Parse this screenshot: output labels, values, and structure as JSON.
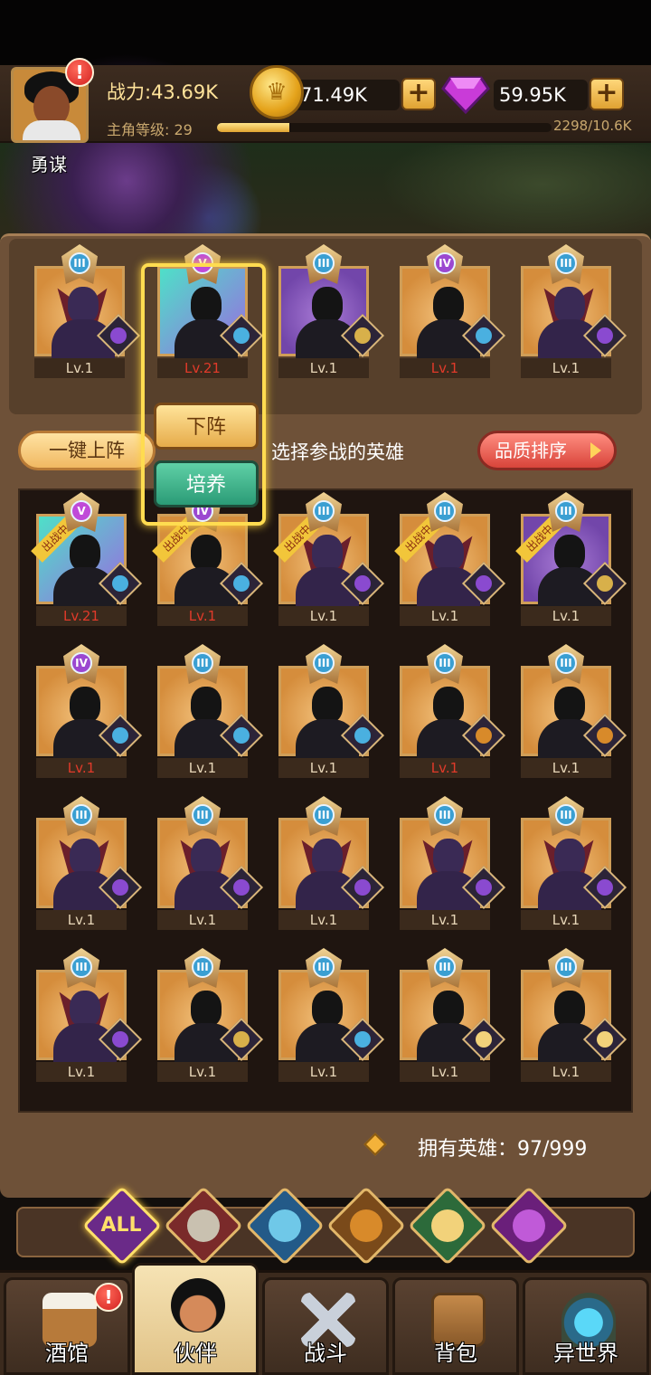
{
  "player": {
    "name": "勇谋",
    "power": "战力:43.69K",
    "level_label": "主角等级: 29",
    "exp_text": "2298/10.6K",
    "exp_progress": 0.217
  },
  "resources": {
    "coins": "71.49K",
    "gems": "59.95K",
    "plus": "+"
  },
  "lineup": [
    {
      "rank": "III",
      "level": "Lv.1",
      "level_red": false
    },
    {
      "rank": "V",
      "level": "Lv.21",
      "level_red": true
    },
    {
      "rank": "III",
      "level": "Lv.1",
      "level_red": false
    },
    {
      "rank": "IV",
      "level": "Lv.1",
      "level_red": true
    },
    {
      "rank": "III",
      "level": "Lv.1",
      "level_red": false
    }
  ],
  "popup": {
    "remove_label": "下阵",
    "train_label": "培养"
  },
  "actions": {
    "one_click_label": "一键上阵",
    "hint": "选择参战的英雄",
    "sort_label": "品质排序"
  },
  "on_field_tag": "出战中",
  "heroes": [
    {
      "rank": "V",
      "level": "Lv.21",
      "red": true,
      "on_field": true
    },
    {
      "rank": "IV",
      "level": "Lv.1",
      "red": true,
      "on_field": true
    },
    {
      "rank": "III",
      "level": "Lv.1",
      "red": false,
      "on_field": true
    },
    {
      "rank": "III",
      "level": "Lv.1",
      "red": false,
      "on_field": true
    },
    {
      "rank": "III",
      "level": "Lv.1",
      "red": false,
      "on_field": true
    },
    {
      "rank": "IV",
      "level": "Lv.1",
      "red": true,
      "on_field": false
    },
    {
      "rank": "III",
      "level": "Lv.1",
      "red": false,
      "on_field": false
    },
    {
      "rank": "III",
      "level": "Lv.1",
      "red": false,
      "on_field": false
    },
    {
      "rank": "III",
      "level": "Lv.1",
      "red": true,
      "on_field": false
    },
    {
      "rank": "III",
      "level": "Lv.1",
      "red": false,
      "on_field": false
    },
    {
      "rank": "III",
      "level": "Lv.1",
      "red": false,
      "on_field": false
    },
    {
      "rank": "III",
      "level": "Lv.1",
      "red": false,
      "on_field": false
    },
    {
      "rank": "III",
      "level": "Lv.1",
      "red": false,
      "on_field": false
    },
    {
      "rank": "III",
      "level": "Lv.1",
      "red": false,
      "on_field": false
    },
    {
      "rank": "III",
      "level": "Lv.1",
      "red": false,
      "on_field": false
    },
    {
      "rank": "III",
      "level": "Lv.1",
      "red": false,
      "on_field": false
    },
    {
      "rank": "III",
      "level": "Lv.1",
      "red": false,
      "on_field": false
    },
    {
      "rank": "III",
      "level": "Lv.1",
      "red": false,
      "on_field": false
    },
    {
      "rank": "III",
      "level": "Lv.1",
      "red": false,
      "on_field": false
    },
    {
      "rank": "III",
      "level": "Lv.1",
      "red": false,
      "on_field": false
    }
  ],
  "owned_heroes": "拥有英雄：97/999",
  "filters": {
    "all_label": "ALL"
  },
  "nav": {
    "tavern": "酒馆",
    "partner": "伙伴",
    "battle": "战斗",
    "bag": "背包",
    "otherworld": "异世界"
  },
  "alert_mark": "!"
}
